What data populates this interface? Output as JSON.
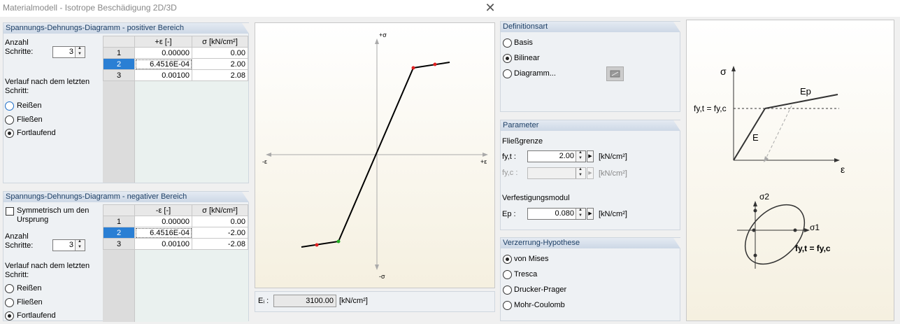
{
  "window": {
    "title": "Materialmodell - Isotrope Beschädigung 2D/3D",
    "close_glyph": "✕"
  },
  "positive": {
    "header": "Spannungs-Dehnungs-Diagramm - positiver Bereich",
    "anzahl": "Anzahl",
    "schritte": "Schritte:",
    "steps_value": "3",
    "columns": [
      "+ε [-]",
      "σ [kN/cm²]"
    ],
    "rows": [
      {
        "n": "1",
        "eps": "0.00000",
        "sig": "0.00"
      },
      {
        "n": "2",
        "eps": "6.4516E-04",
        "sig": "2.00"
      },
      {
        "n": "3",
        "eps": "0.00100",
        "sig": "2.08"
      }
    ],
    "verlauf": "Verlauf nach dem letzten Schritt:",
    "options": [
      "Reißen",
      "Fließen",
      "Fortlaufend"
    ],
    "selected": 2
  },
  "negative": {
    "header": "Spannungs-Dehnungs-Diagramm - negativer Bereich",
    "symmetrisch": "Symmetrisch um den Ursprung",
    "anzahl": "Anzahl",
    "schritte": "Schritte:",
    "steps_value": "3",
    "columns": [
      "-ε [-]",
      "σ [kN/cm²]"
    ],
    "rows": [
      {
        "n": "1",
        "eps": "0.00000",
        "sig": "0.00"
      },
      {
        "n": "2",
        "eps": "6.4516E-04",
        "sig": "-2.00"
      },
      {
        "n": "3",
        "eps": "0.00100",
        "sig": "-2.08"
      }
    ],
    "verlauf": "Verlauf nach dem letzten Schritt:",
    "options": [
      "Reißen",
      "Fließen",
      "Fortlaufend"
    ],
    "selected": 2
  },
  "diagram": {
    "label_top": "+σ",
    "label_bottom": "-σ",
    "label_left": "-ε",
    "label_right": "+ε",
    "ei_label": "Eᵢ :",
    "ei_value": "3100.00",
    "ei_unit": "[kN/cm²]",
    "line_color": "#000000",
    "point_color_red": "#e02020",
    "point_color_green": "#20b020"
  },
  "definitionsart": {
    "header": "Definitionsart",
    "options": [
      "Basis",
      "Bilinear",
      "Diagramm..."
    ],
    "selected": 1
  },
  "parameter": {
    "header": "Parameter",
    "fliess": "Fließgrenze",
    "fyt_label": "fy,t :",
    "fyt_value": "2.00",
    "fyt_unit": "[kN/cm²]",
    "fyc_label": "fy,c :",
    "fyc_unit": "[kN/cm²]",
    "verf": "Verfestigungsmodul",
    "ep_label": "Ep :",
    "ep_value": "0.080",
    "ep_unit": "[kN/cm²]"
  },
  "hypothese": {
    "header": "Verzerrung-Hypothese",
    "options": [
      "von Mises",
      "Tresca",
      "Drucker-Prager",
      "Mohr-Coulomb"
    ],
    "selected": 0
  },
  "illustration": {
    "sigma": "σ",
    "epsilon": "ε",
    "ep": "Ep",
    "e": "E",
    "fy": "fy,t = fy,c",
    "sigma1": "σ1",
    "sigma2": "σ2",
    "fy2": "fy,t = fy,c"
  }
}
